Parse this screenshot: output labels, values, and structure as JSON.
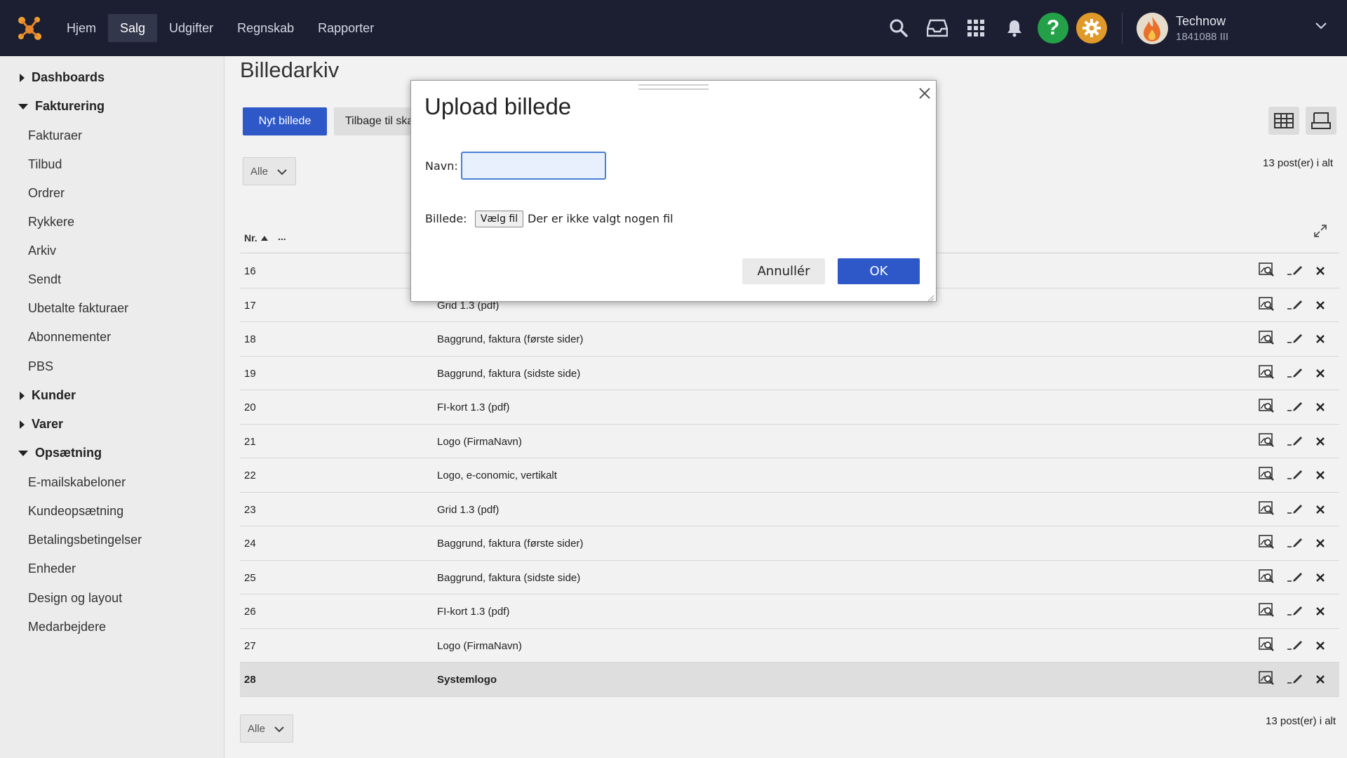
{
  "topbar": {
    "nav": [
      "Hjem",
      "Salg",
      "Udgifter",
      "Regnskab",
      "Rapporter"
    ],
    "active_nav": "Salg",
    "help_symbol": "?",
    "user": {
      "name": "Technow",
      "account": "1841088 III"
    },
    "icons": [
      "search-icon",
      "inbox-icon",
      "apps-grid-icon",
      "bell-icon",
      "help-icon",
      "gear-icon",
      "chevron-down-icon"
    ],
    "colors": {
      "bar": "#1c1f32",
      "help": "#24a148",
      "settings": "#e09a2a"
    }
  },
  "sidebar": {
    "groups": [
      {
        "label": "Dashboards",
        "expanded": false
      },
      {
        "label": "Fakturering",
        "expanded": true,
        "items": [
          "Fakturaer",
          "Tilbud",
          "Ordrer",
          "Rykkere",
          "Arkiv",
          "Sendt",
          "Ubetalte fakturaer",
          "Abonnementer",
          "PBS"
        ]
      },
      {
        "label": "Kunder",
        "expanded": false
      },
      {
        "label": "Varer",
        "expanded": false
      },
      {
        "label": "Opsætning",
        "expanded": true,
        "items": [
          "E-mailskabeloner",
          "Kundeopsætning",
          "Betalingsbetingelser",
          "Enheder",
          "Design og layout",
          "Medarbejdere"
        ]
      }
    ]
  },
  "main": {
    "title": "Billedarkiv",
    "new_button": "Nyt billede",
    "back_button": "Tilbage til skabeloner",
    "filter_top": "Alle",
    "filter_bottom": "Alle",
    "count_top": "13 post(er) i alt",
    "count_bottom": "13 post(er) i alt",
    "table": {
      "col_nr": "Nr.",
      "col_more": "...",
      "rows": [
        {
          "nr": "16",
          "name": ""
        },
        {
          "nr": "17",
          "name": "Grid 1.3 (pdf)"
        },
        {
          "nr": "18",
          "name": "Baggrund, faktura (første sider)"
        },
        {
          "nr": "19",
          "name": "Baggrund, faktura (sidste side)"
        },
        {
          "nr": "20",
          "name": "FI-kort 1.3 (pdf)"
        },
        {
          "nr": "21",
          "name": "Logo (FirmaNavn)"
        },
        {
          "nr": "22",
          "name": "Logo, e-conomic, vertikalt"
        },
        {
          "nr": "23",
          "name": "Grid 1.3 (pdf)"
        },
        {
          "nr": "24",
          "name": "Baggrund, faktura (første sider)"
        },
        {
          "nr": "25",
          "name": "Baggrund, faktura (sidste side)"
        },
        {
          "nr": "26",
          "name": "FI-kort 1.3 (pdf)"
        },
        {
          "nr": "27",
          "name": "Logo (FirmaNavn)"
        },
        {
          "nr": "28",
          "name": "Systemlogo",
          "selected": true
        }
      ]
    }
  },
  "dialog": {
    "title": "Upload billede",
    "name_label": "Navn:",
    "name_value": "",
    "image_label": "Billede:",
    "file_button": "Vælg fil",
    "file_status": "Der er ikke valgt nogen fil",
    "cancel_button": "Annullér",
    "ok_button": "OK"
  }
}
